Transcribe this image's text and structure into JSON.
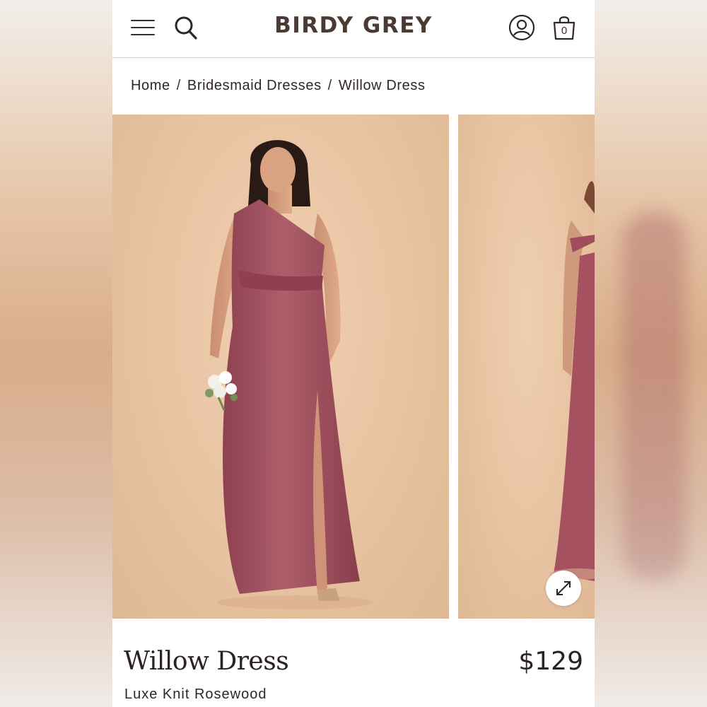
{
  "header": {
    "logo": "BIRDY GREY",
    "cart_count": "0"
  },
  "breadcrumb": {
    "items": [
      "Home",
      "Bridesmaid Dresses",
      "Willow Dress"
    ],
    "separator": "/"
  },
  "gallery": {
    "slides": [
      {
        "alt": "Model wearing one-shoulder rosewood maxi dress holding a white bouquet"
      },
      {
        "alt": "Model wearing off-shoulder rosewood dress, side view"
      }
    ],
    "expand_icon": "expand-arrows-icon"
  },
  "product": {
    "name": "Willow Dress",
    "price": "$129",
    "color": "Luxe Knit Rosewood"
  },
  "colors": {
    "dress": "#a4515f",
    "backdrop": "#e8c3a2",
    "text": "#2b2320",
    "logo": "#4a3a33"
  }
}
